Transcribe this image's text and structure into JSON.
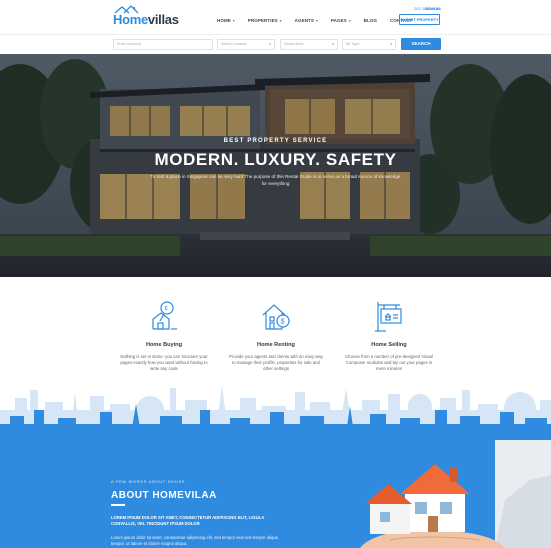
{
  "header": {
    "logo_part1": "Home",
    "logo_part2": "villas",
    "phone": "202-555-0183",
    "signin": "SIGN IN",
    "nav": [
      {
        "label": "HOME",
        "has_caret": true
      },
      {
        "label": "PROPERTIES",
        "has_caret": true
      },
      {
        "label": "AGENTS",
        "has_caret": true
      },
      {
        "label": "PAGES",
        "has_caret": true
      },
      {
        "label": "BLOG",
        "has_caret": false
      },
      {
        "label": "CONTACT",
        "has_caret": false
      }
    ],
    "submit_label": "SUBMIT PROPERTY"
  },
  "search": {
    "keyword_placeholder": "Enter keyword",
    "location_placeholder": "Select Location",
    "area_placeholder": "Select Area",
    "type_placeholder": "All Type",
    "button_label": "SEARCH"
  },
  "hero": {
    "subtitle": "BEST PROPERTY SERVICE",
    "title": "MODERN. LUXURY. SAFETY",
    "description": "To rent a place in Singapore can be very hard The purpose of this Rental Guide is to serve as a broad source of knowledge for everything"
  },
  "services": [
    {
      "icon": "home-buying-icon",
      "title": "Home Buying",
      "desc": "Nothing is set in stone: you can structure your pages exactly how you want without having to write any code"
    },
    {
      "icon": "home-renting-icon",
      "title": "Home Renting",
      "desc": "Provide your agents and clients with an easy way to manage their profile, properties for sale and other settings"
    },
    {
      "icon": "home-selling-icon",
      "title": "Home Selling",
      "desc": "Choose from a number of pre-designed Visual Composer modules and lay out your pages in mere minutes"
    }
  ],
  "about": {
    "kicker": "A FEW WORDS ABOUT HOUSE",
    "title": "ABOUT HOMEVILAA",
    "lead": "LOREM IPSUM DOLOR SIT AMET, CONSECTETUR ADIPISCING ELIT, LIGULA CONVALLIS, VEL TINCIDUNT IPSUM DOLOR",
    "body": "Lorem ipsum dolor sit amet, consectetur adipiscing elit, sed tempor eius nisl tempor aliqua tempor, ut labore et dolore magna aliqua."
  },
  "colors": {
    "accent": "#2e8be0",
    "dark_text": "#2f3a4a",
    "roof_orange": "#f06a3a"
  }
}
